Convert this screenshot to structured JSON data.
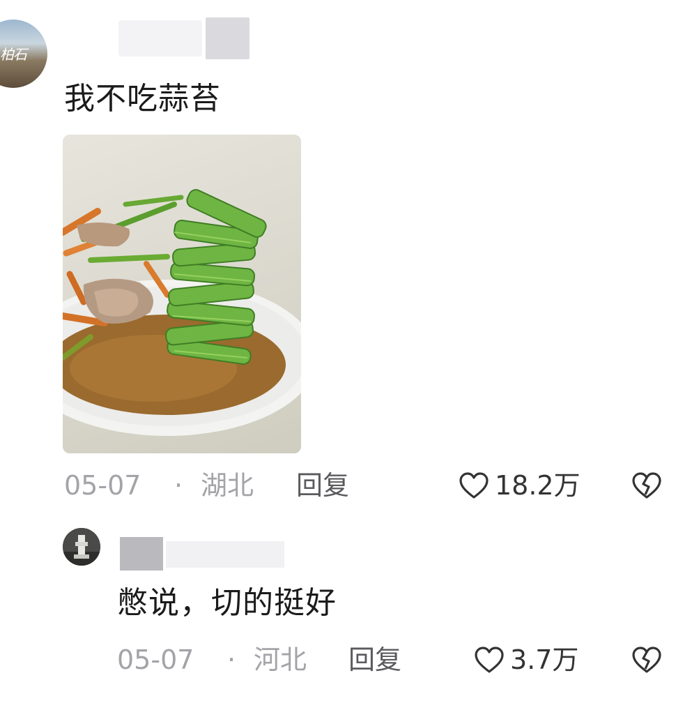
{
  "comments": [
    {
      "text": "我不吃蒜苔",
      "date": "05-07",
      "separator": "·",
      "location": "湖北",
      "reply_label": "回复",
      "likes": "18.2万",
      "avatar_text": "柏石"
    },
    {
      "text": "憋说，切的挺好",
      "date": "05-07",
      "separator": "·",
      "location": "河北",
      "reply_label": "回复",
      "likes": "3.7万"
    }
  ],
  "icons": {
    "like": "heart-outline-icon",
    "dislike": "broken-heart-icon"
  },
  "colors": {
    "meta_gray": "#a3a3a8",
    "reply_gray": "#5a5a5e",
    "text": "#1b1b1b"
  }
}
